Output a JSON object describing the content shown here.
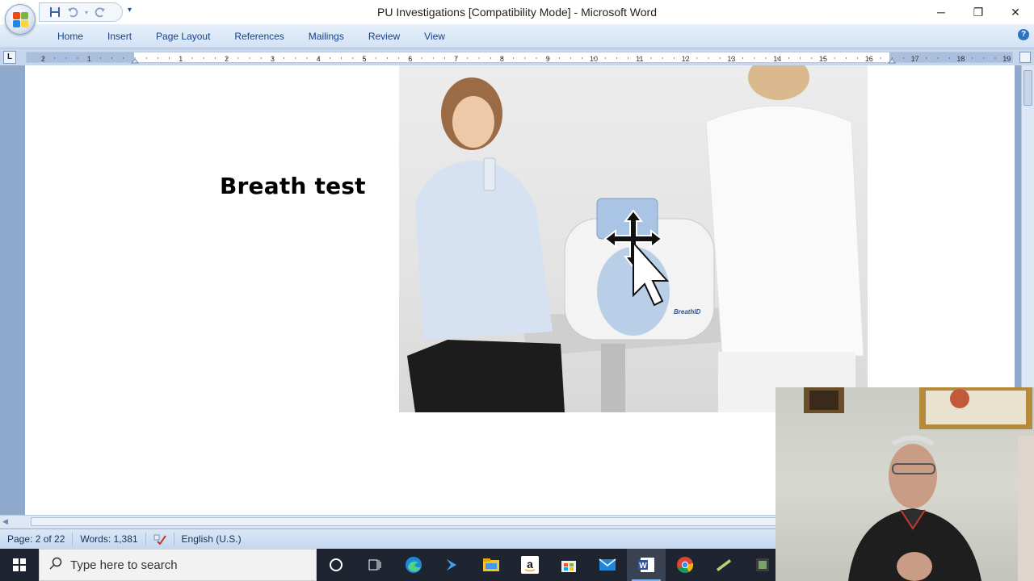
{
  "window": {
    "title": "PU Investigations [Compatibility Mode] - Microsoft Word",
    "controls": {
      "minimize": "─",
      "restore": "❐",
      "close": "✕"
    }
  },
  "qat": {
    "more": "▾"
  },
  "ribbon": {
    "tabs": [
      {
        "label": "Home"
      },
      {
        "label": "Insert"
      },
      {
        "label": "Page Layout"
      },
      {
        "label": "References"
      },
      {
        "label": "Mailings"
      },
      {
        "label": "Review"
      },
      {
        "label": "View"
      }
    ],
    "help": "?"
  },
  "ruler": {
    "tab_selector": "L",
    "left_labels": [
      "2",
      "1"
    ],
    "right_labels": [
      "1",
      "2",
      "3",
      "4",
      "5",
      "6",
      "7",
      "8",
      "9",
      "10",
      "11",
      "12",
      "13",
      "14",
      "15",
      "16",
      "17",
      "18",
      "19"
    ]
  },
  "document": {
    "heading": "Breath test",
    "image_label": "BreathID"
  },
  "statusbar": {
    "page": "Page: 2 of 22",
    "words": "Words: 1,381",
    "language": "English (U.S.)"
  },
  "taskbar": {
    "search_placeholder": "Type here to search",
    "apps": [
      {
        "icon": "cortana-icon"
      },
      {
        "icon": "task-view-icon"
      },
      {
        "icon": "edge-icon"
      },
      {
        "icon": "visual-studio-icon"
      },
      {
        "icon": "file-explorer-icon"
      },
      {
        "icon": "amazon-icon"
      },
      {
        "icon": "store-icon"
      },
      {
        "icon": "mail-icon"
      },
      {
        "icon": "word-icon",
        "active": true
      },
      {
        "icon": "chrome-icon"
      },
      {
        "icon": "app-icon"
      },
      {
        "icon": "app2-icon"
      }
    ]
  },
  "colors": {
    "ribbon_text": "#15428b",
    "page_background": "#ffffff",
    "taskbar": "#1f2530"
  }
}
